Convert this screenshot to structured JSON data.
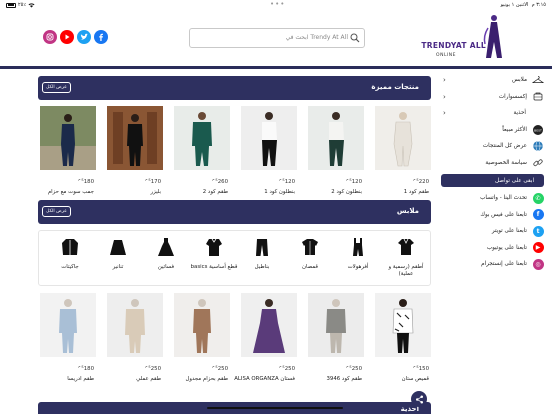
{
  "status": {
    "time": "٣:١٥ م",
    "date": "الاثنين ١ يونيو",
    "battery": "٢٥٪"
  },
  "brand": {
    "name": "TRENDYAT ALL",
    "sub": "ONLINE"
  },
  "search": {
    "placeholder": "Trendy At All ابحث في"
  },
  "social": [
    {
      "name": "instagram-icon",
      "color": "#c13584"
    },
    {
      "name": "youtube-icon",
      "color": "#ff0000"
    },
    {
      "name": "twitter-icon",
      "color": "#1da1f2"
    },
    {
      "name": "facebook-icon",
      "color": "#1877f2"
    }
  ],
  "sidebar": {
    "items": [
      {
        "label": "ملابس",
        "icon": "hanger-icon",
        "chevron": true
      },
      {
        "label": "إكسسوارات",
        "icon": "accessories-icon",
        "chevron": true
      },
      {
        "label": "أحذية",
        "icon": "",
        "chevron": true
      },
      {
        "label": "الأكثر مبيعاً",
        "icon": "best-seller-icon",
        "chevron": false
      },
      {
        "label": "عرض كل المنتجات",
        "icon": "globe-icon",
        "chevron": false
      },
      {
        "label": "سياسة الخصوصية",
        "icon": "link-icon",
        "chevron": false
      }
    ],
    "contact_button": "ابقى على تواصل",
    "contact_items": [
      {
        "label": "تحدث الينا - واتساب",
        "icon": "whatsapp-icon",
        "color": "#25d366"
      },
      {
        "label": "تابعنا على فيس بوك",
        "icon": "facebook-icon",
        "color": "#1877f2"
      },
      {
        "label": "تابعنا على تويتر",
        "icon": "twitter-icon",
        "color": "#1da1f2"
      },
      {
        "label": "تابعنا على يوتيوب",
        "icon": "youtube-icon",
        "color": "#ff0000"
      },
      {
        "label": "تابعنا على إنستجرام",
        "icon": "instagram-icon",
        "color": "#c13584"
      }
    ]
  },
  "featured": {
    "title": "منتجات مميزة",
    "view_all": "عرض الكل",
    "products": [
      {
        "price": "220",
        "currency": "ج.م",
        "name": "طقم كود 1"
      },
      {
        "price": "120",
        "currency": "ج.م",
        "name": "بنطلون كود 2"
      },
      {
        "price": "120",
        "currency": "ج.م",
        "name": "بنطلون كود 1"
      },
      {
        "price": "260",
        "currency": "ج.م",
        "name": "طقم كود 2"
      },
      {
        "price": "170",
        "currency": "ج.م",
        "name": "بليزر"
      },
      {
        "price": "180",
        "currency": "ج.م",
        "name": "جمب سوت مع حزام"
      }
    ]
  },
  "clothes": {
    "title": "ملابس",
    "view_all": "عرض الكل",
    "categories": [
      {
        "label": "أطقم (رسمية و عملية)",
        "icon": "set-icon"
      },
      {
        "label": "أفرهولات",
        "icon": "overall-icon"
      },
      {
        "label": "قمصان",
        "icon": "shirt-icon"
      },
      {
        "label": "بناطيل",
        "icon": "pants-icon"
      },
      {
        "label": "قطع أساسية basics",
        "icon": "basics-icon"
      },
      {
        "label": "فساتين",
        "icon": "dress-icon"
      },
      {
        "label": "تنانير",
        "icon": "skirt-icon"
      },
      {
        "label": "جاكيتات",
        "icon": "jacket-icon"
      }
    ],
    "products": [
      {
        "price": "150",
        "currency": "ج.م",
        "name": "قميص ستان"
      },
      {
        "price": "250",
        "currency": "ج.م",
        "name": "طقم كود 3946"
      },
      {
        "price": "250",
        "currency": "ج.م",
        "name": "فستان ALISA ORGANZA"
      },
      {
        "price": "250",
        "currency": "ج.م",
        "name": "طقم بحزام مجدول"
      },
      {
        "price": "250",
        "currency": "ج.م",
        "name": "طقم عملي"
      },
      {
        "price": "180",
        "currency": "ج.م",
        "name": "طقم ادريسا"
      }
    ]
  },
  "shoes": {
    "title": "أحذية"
  }
}
